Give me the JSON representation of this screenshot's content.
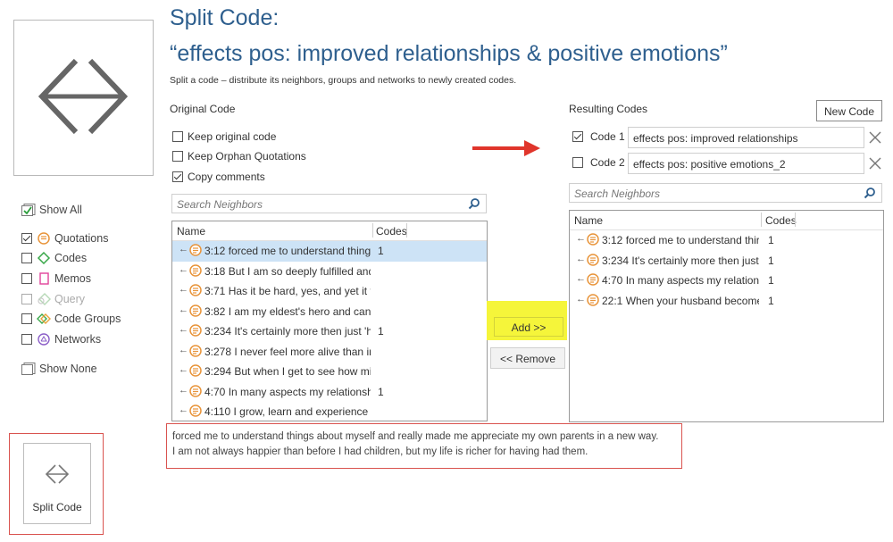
{
  "header": {
    "title_line1": "Split Code:",
    "title_line2": "“effects pos: improved relationships & positive emotions”",
    "subtitle": "Split a code – distribute its neighbors, groups and networks to newly created codes."
  },
  "sidebar": {
    "show_all": "Show All",
    "items": [
      {
        "label": "Quotations",
        "checked": true,
        "icon": "quotation-icon"
      },
      {
        "label": "Codes",
        "checked": false,
        "icon": "code-icon"
      },
      {
        "label": "Memos",
        "checked": false,
        "icon": "memo-icon"
      },
      {
        "label": "Query",
        "checked": false,
        "icon": "query-icon",
        "disabled": true
      },
      {
        "label": "Code Groups",
        "checked": false,
        "icon": "code-groups-icon"
      },
      {
        "label": "Networks",
        "checked": false,
        "icon": "networks-icon"
      }
    ],
    "show_none": "Show None"
  },
  "original": {
    "heading": "Original Code",
    "options": [
      {
        "label": "Keep original code",
        "checked": false
      },
      {
        "label": "Keep Orphan Quotations",
        "checked": false
      },
      {
        "label": "Copy comments",
        "checked": true
      }
    ],
    "search_placeholder": "Search Neighbors",
    "col_name": "Name",
    "col_codes": "Codes",
    "rows": [
      {
        "id": "3:12",
        "text": "3:12 forced me to understand thing",
        "codes": "1",
        "selected": true
      },
      {
        "id": "3:18",
        "text": "3:18 But I am so deeply fulfilled and",
        "codes": "",
        "selected": false
      },
      {
        "id": "3:71",
        "text": "3:71 Has it be hard, yes, and yet it v",
        "codes": "",
        "selected": false
      },
      {
        "id": "3:82",
        "text": "3:82 I am my eldest's hero and can",
        "codes": "",
        "selected": false
      },
      {
        "id": "3:234",
        "text": "3:234 It's certainly more then just 'h",
        "codes": "1",
        "selected": false
      },
      {
        "id": "3:278",
        "text": "3:278 I never feel more alive than in",
        "codes": "",
        "selected": false
      },
      {
        "id": "3:294",
        "text": "3:294 But when I get to see how mi",
        "codes": "",
        "selected": false
      },
      {
        "id": "4:70",
        "text": "4:70 In many aspects my relationsh",
        "codes": "1",
        "selected": false
      },
      {
        "id": "4:110",
        "text": "4:110 I grow, learn and experience l",
        "codes": "",
        "selected": false
      }
    ]
  },
  "actions": {
    "add": "Add >>",
    "remove": "<< Remove"
  },
  "resulting": {
    "heading": "Resulting Codes",
    "new_code": "New Code",
    "codes": [
      {
        "label": "Code 1",
        "value": "effects pos: improved relationships",
        "checked": true
      },
      {
        "label": "Code 2",
        "value": "effects pos: positive emotions_2",
        "checked": false
      }
    ],
    "search_placeholder": "Search Neighbors",
    "col_name": "Name",
    "col_codes": "Codes",
    "rows": [
      {
        "text": "3:12 forced me to understand thir",
        "codes": "1"
      },
      {
        "text": "3:234 It's certainly more then just",
        "codes": "1"
      },
      {
        "text": "4:70 In many aspects my relations",
        "codes": "1"
      },
      {
        "text": "22:1 When your husband become",
        "codes": "1"
      }
    ]
  },
  "preview": {
    "line1": "forced me to understand things about myself and really made me appreciate my own parents in a new way.",
    "line2": "I am not always happier than before I had children, but my life is richer for having had them."
  },
  "ribbon": {
    "split_code_label": "Split Code"
  },
  "colors": {
    "title": "#2e5f8e",
    "highlight_box": "#d9534f",
    "add_highlight": "#f5f53a",
    "arrow": "#e0352b",
    "selected_row": "#cde3f6",
    "quotation_icon": "#e8943a"
  }
}
